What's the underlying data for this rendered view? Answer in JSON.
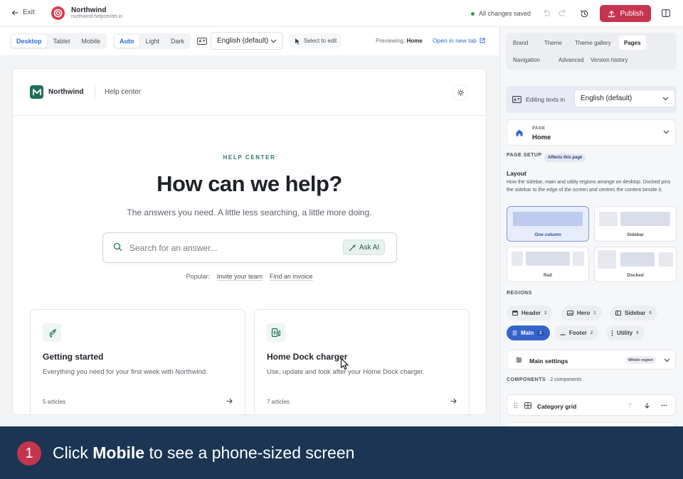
{
  "topbar": {
    "exit_label": "Exit",
    "brand_name": "Northwind",
    "brand_url": "northwind.helpcenter.io",
    "save_status": "All changes saved",
    "publish_label": "Publish"
  },
  "toolbar": {
    "devices": [
      "Desktop",
      "Tablet",
      "Mobile"
    ],
    "active_device": "Desktop",
    "themes": [
      "Auto",
      "Light",
      "Dark"
    ],
    "active_theme": "Auto",
    "language": "English (default)",
    "select_to_edit": "Select to edit",
    "previewing_label": "Previewing:",
    "previewing_page": "Home",
    "open_new_tab": "Open in new tab"
  },
  "preview": {
    "site_name": "Northwind",
    "site_section": "Help center",
    "eyebrow": "HELP CENTER",
    "title": "How can we help?",
    "subtitle": "The answers you need. A little less searching, a little more doing.",
    "search_placeholder": "Search for an answer...",
    "ask_ai": "Ask AI",
    "popular_label": "Popular:",
    "popular_links": [
      "Invite your team",
      "Find an invoice"
    ],
    "cards": [
      {
        "title": "Getting started",
        "description": "Everything you need for your first week with Northwind.",
        "count": "5 articles",
        "icon": "rocket-icon"
      },
      {
        "title": "Home Dock charger",
        "description": "Use, update and look after your Home Dock charger.",
        "count": "7 articles",
        "icon": "ev-charger-icon"
      }
    ]
  },
  "panel": {
    "tabs": [
      "Brand",
      "Theme",
      "Theme gallery",
      "Pages",
      "Navigation",
      "Advanced",
      "Version history"
    ],
    "active_tab": "Pages",
    "editing_label": "Editing texts in",
    "editing_language": "English (default)",
    "page_kicker": "PAGE",
    "page_name": "Home",
    "page_setup": "PAGE SETUP",
    "page_setup_pill": "Affects this page",
    "layout_title": "Layout",
    "layout_desc": "How the sidebar, main and utility regions arrange on desktop. Docked pins the sidebar to the edge of the screen and centres the content beside it.",
    "layouts": [
      "One column",
      "Sidebar",
      "Rail",
      "Docked"
    ],
    "selected_layout": "One column",
    "regions_title": "REGIONS",
    "regions": [
      {
        "name": "Header",
        "count": "2",
        "icon": "header-icon"
      },
      {
        "name": "Hero",
        "count": "1",
        "icon": "hero-icon"
      },
      {
        "name": "Sidebar",
        "count": "0",
        "icon": "sidebar-icon"
      },
      {
        "name": "Main",
        "count": "2",
        "icon": "main-icon"
      },
      {
        "name": "Footer",
        "count": "2",
        "icon": "footer-icon"
      },
      {
        "name": "Utility",
        "count": "0",
        "icon": "utility-icon"
      }
    ],
    "active_region": "Main",
    "main_settings": "Main settings",
    "main_settings_pill": "Whole region",
    "components_title": "COMPONENTS",
    "components_count": "· 2 components",
    "component_1": "Category grid"
  },
  "caption": {
    "step": "1",
    "prefix": "Click",
    "target": "Mobile",
    "suffix": "to see a phone-sized screen"
  },
  "colors": {
    "accent_blue": "#2a6fd1",
    "publish_red": "#c6354f",
    "brand_green": "#1f6f5c",
    "caption_bg": "#1b3553"
  }
}
